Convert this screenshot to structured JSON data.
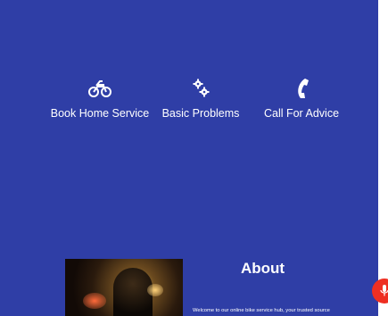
{
  "services": [
    {
      "label": "Book Home Service",
      "icon": "motorcycle-icon"
    },
    {
      "label": "Basic Problems",
      "icon": "gears-icon"
    },
    {
      "label": "Call For Advice",
      "icon": "phone-icon"
    }
  ],
  "about": {
    "title": "About",
    "text": "Welcome to our online bike service hub, your trusted source"
  },
  "colors": {
    "panel_bg": "#2f3ea6",
    "mic_button": "#ee2f22"
  },
  "mic_button": {
    "icon": "microphone-icon"
  }
}
